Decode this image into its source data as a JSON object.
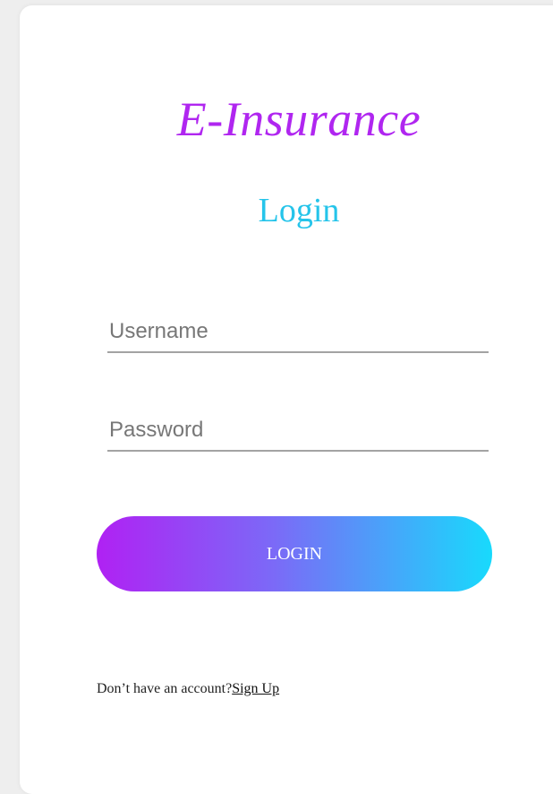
{
  "app": {
    "brand": "E-Insurance"
  },
  "login_form": {
    "title": "Login",
    "username": {
      "placeholder": "Username",
      "value": ""
    },
    "password": {
      "placeholder": "Password",
      "value": ""
    },
    "submit_label": "LOGIN",
    "signup_prompt": "Don’t have an account?",
    "signup_link": "Sign Up"
  },
  "colors": {
    "brand": "#b026f0",
    "title": "#25c4ea",
    "button_gradient_start": "#b021f3",
    "button_gradient_end": "#18dafc"
  }
}
